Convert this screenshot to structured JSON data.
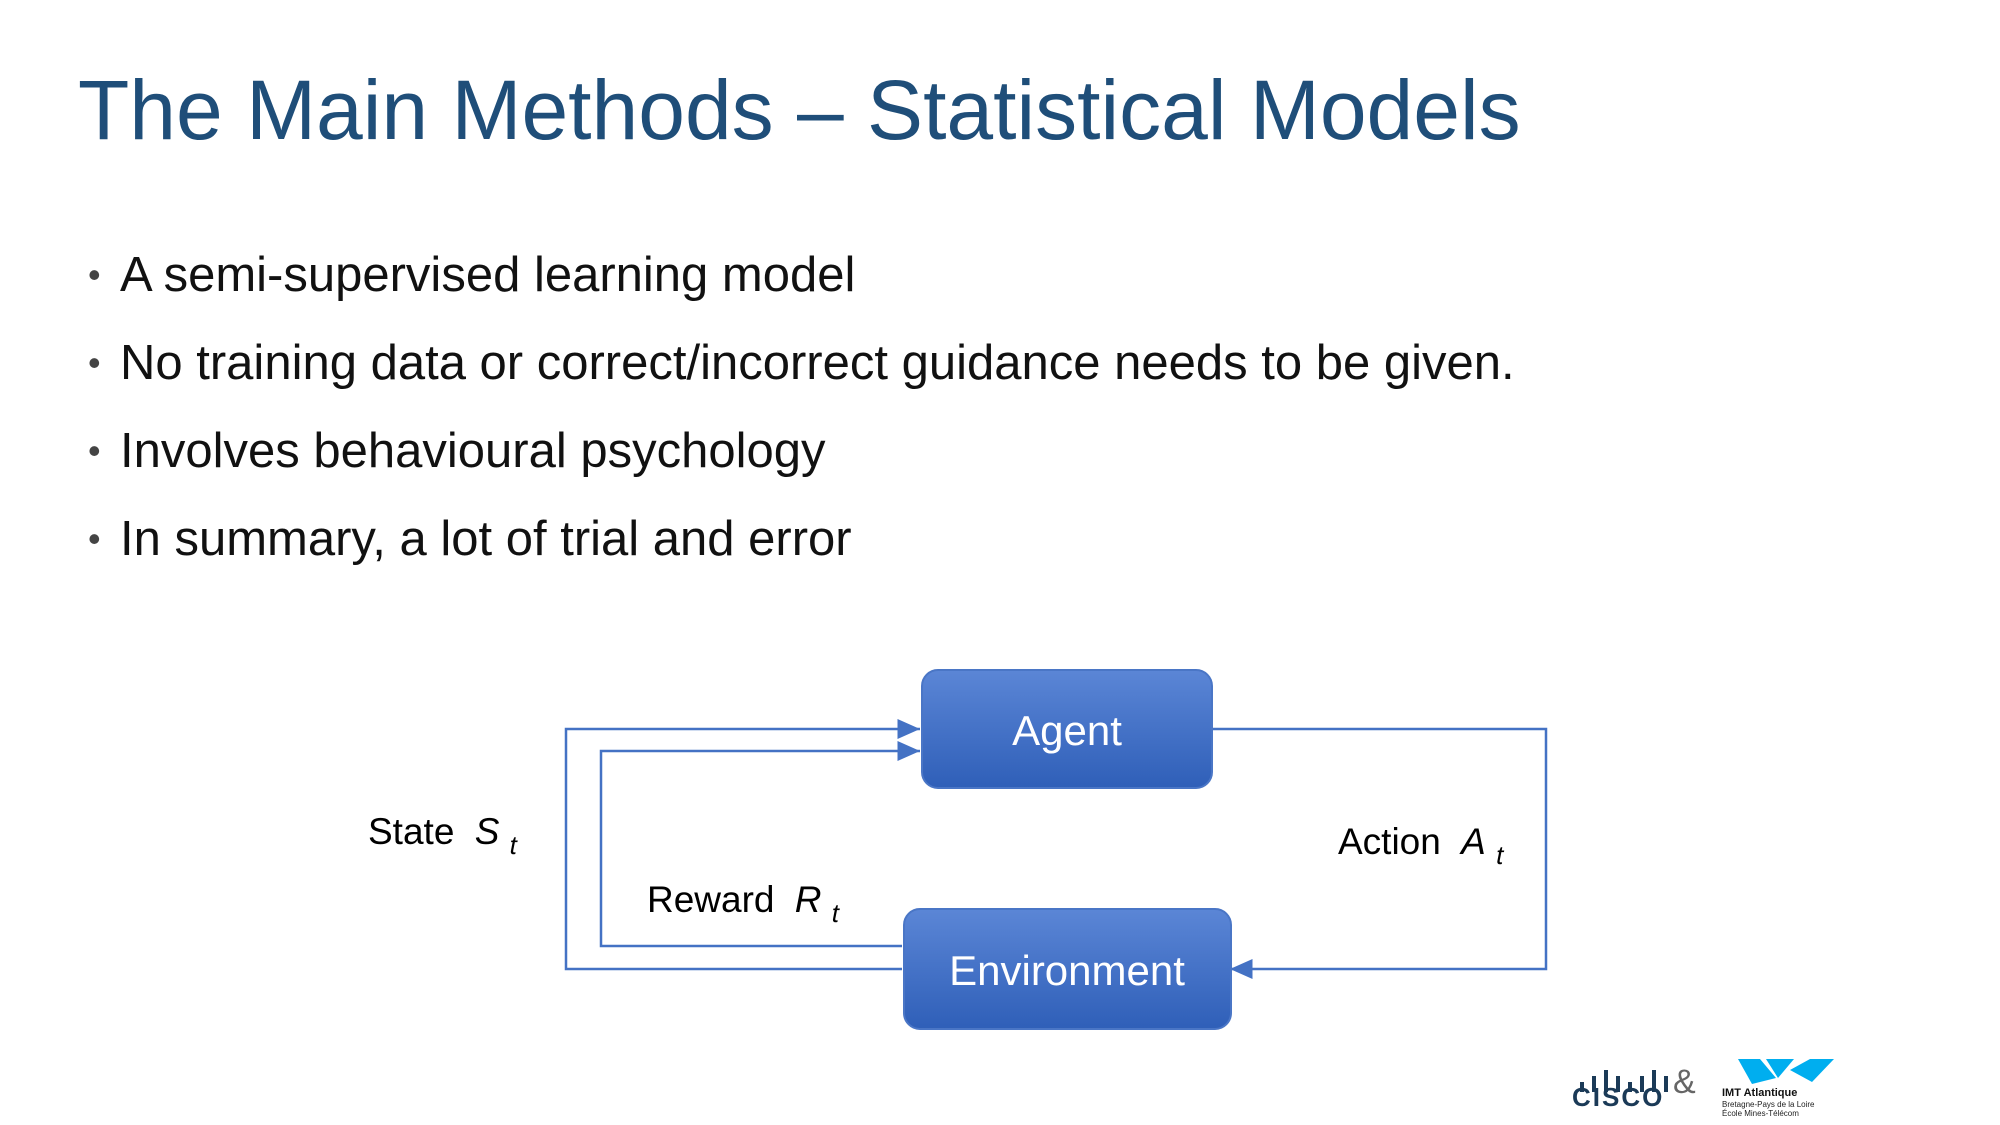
{
  "slide": {
    "title": "The Main Methods – Statistical Models",
    "bullets": [
      "A semi-supervised learning model",
      "No training data or correct/incorrect guidance needs to be given.",
      "Involves behavioural psychology",
      "In summary, a lot of trial and error"
    ],
    "bullet_glyph": "•"
  },
  "diagram": {
    "agent_label": "Agent",
    "environment_label": "Environment",
    "state_label": "State",
    "state_var": "S",
    "state_sub": "t",
    "reward_label": "Reward",
    "reward_var": "R",
    "reward_sub": "t",
    "action_label": "Action",
    "action_var": "A",
    "action_sub": "t",
    "box_color": "#4472c4",
    "line_color": "#4472c4"
  },
  "footer": {
    "cisco_text": "CISCO",
    "amp": "&",
    "imt_title": "IMT Atlantique",
    "imt_line1": "Bretagne-Pays de la Loire",
    "imt_line2": "École Mines-Télécom"
  }
}
